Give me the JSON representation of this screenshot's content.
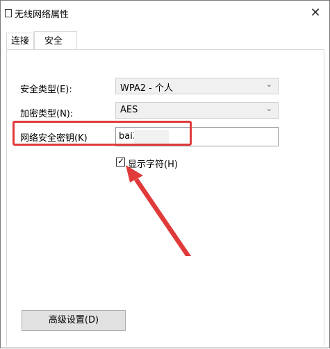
{
  "window": {
    "title": "无线网络属性",
    "close_glyph": "✕"
  },
  "tabs": [
    {
      "label": "连接"
    },
    {
      "label": "安全"
    }
  ],
  "security_type": {
    "label": "安全类型(E):",
    "value": "WPA2 - 个人"
  },
  "encryption_type": {
    "label": "加密类型(N):",
    "value": "AES"
  },
  "network_key": {
    "label": "网络安全密钥(K)",
    "value": "bai3"
  },
  "show_characters": {
    "label": "显示字符(H)",
    "checked": true
  },
  "advanced_button": {
    "label": "高级设置(D)"
  },
  "annotation_color": "#e03a3a"
}
